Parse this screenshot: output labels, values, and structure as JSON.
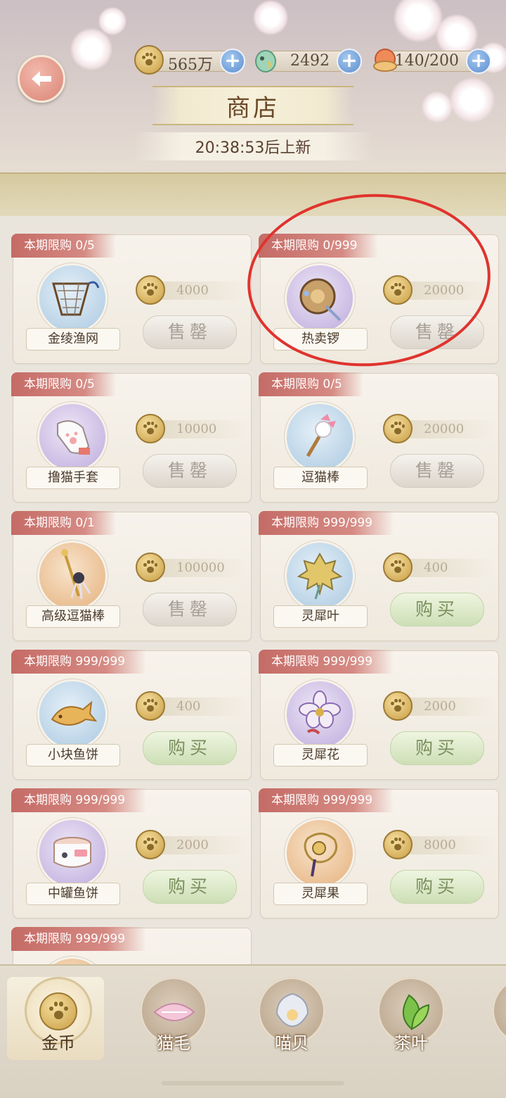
{
  "header": {
    "title": "商店",
    "refresh_text": "20:38:53后上新",
    "resources": [
      {
        "icon": "gold-coin-icon",
        "value": "565万"
      },
      {
        "icon": "bird-token-icon",
        "value": "2492"
      },
      {
        "icon": "food-bowl-icon",
        "value": "140/200"
      }
    ]
  },
  "items": [
    {
      "limit": "本期限购 0/5",
      "name": "金绫渔网",
      "price": "4000",
      "action": "售罄",
      "state": "sold",
      "bg": "blue",
      "icon": "fishing-net-icon"
    },
    {
      "limit": "本期限购 0/999",
      "name": "热卖锣",
      "price": "20000",
      "action": "售罄",
      "state": "sold",
      "bg": "purple",
      "icon": "gong-icon"
    },
    {
      "limit": "本期限购 0/5",
      "name": "撸猫手套",
      "price": "10000",
      "action": "售罄",
      "state": "sold",
      "bg": "purple",
      "icon": "cat-glove-icon"
    },
    {
      "limit": "本期限购 0/5",
      "name": "逗猫棒",
      "price": "20000",
      "action": "售罄",
      "state": "sold",
      "bg": "blue",
      "icon": "cat-wand-icon"
    },
    {
      "limit": "本期限购 0/1",
      "name": "高级逗猫棒",
      "price": "100000",
      "action": "售罄",
      "state": "sold",
      "bg": "orange",
      "icon": "premium-cat-wand-icon"
    },
    {
      "limit": "本期限购 999/999",
      "name": "灵犀叶",
      "price": "400",
      "action": "购买",
      "state": "buy",
      "bg": "blue",
      "icon": "leaf-charm-icon"
    },
    {
      "limit": "本期限购 999/999",
      "name": "小块鱼饼",
      "price": "400",
      "action": "购买",
      "state": "buy",
      "bg": "blue",
      "icon": "fish-cake-icon"
    },
    {
      "limit": "本期限购 999/999",
      "name": "灵犀花",
      "price": "2000",
      "action": "购买",
      "state": "buy",
      "bg": "purple",
      "icon": "flower-charm-icon"
    },
    {
      "limit": "本期限购 999/999",
      "name": "中罐鱼饼",
      "price": "2000",
      "action": "购买",
      "state": "buy",
      "bg": "purple",
      "icon": "fish-can-icon"
    },
    {
      "limit": "本期限购 999/999",
      "name": "灵犀果",
      "price": "8000",
      "action": "购买",
      "state": "buy",
      "bg": "orange",
      "icon": "fruit-charm-icon"
    },
    {
      "limit": "本期限购 999/999"
    }
  ],
  "tabs": [
    {
      "label": "金币",
      "icon": "gold-coin-icon",
      "active": true
    },
    {
      "label": "猫毛",
      "icon": "cat-fur-icon",
      "active": false
    },
    {
      "label": "喵贝",
      "icon": "shell-icon",
      "active": false
    },
    {
      "label": "茶叶",
      "icon": "tea-leaf-icon",
      "active": false
    }
  ],
  "colors": {
    "annotation_circle": "#e0332e",
    "sold_text": "#a59f96",
    "buy_text": "#7b8f5e",
    "limit_banner": "#c56b66"
  }
}
